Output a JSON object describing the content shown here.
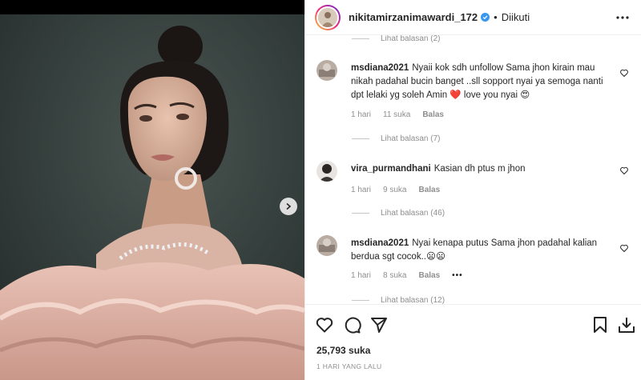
{
  "header": {
    "username": "nikitamirzanimawardi_172",
    "separator": "•",
    "follow_state": "Diikuti"
  },
  "comments": {
    "top_replies": "Lihat balasan (2)",
    "items": [
      {
        "username": "msdiana2021",
        "text": "Nyaii kok sdh unfollow Sama jhon kirain mau nikah padahal bucin banget ..sll sopport nyai ya semoga nanti dpt lelaki yg soleh Amin ❤️ love you nyai 😍",
        "time": "1 hari",
        "likes": "11 suka",
        "reply": "Balas",
        "replies": "Lihat balasan (7)"
      },
      {
        "username": "vira_purmandhani",
        "text": "Kasian dh ptus m jhon",
        "time": "1 hari",
        "likes": "9 suka",
        "reply": "Balas",
        "replies": "Lihat balasan (46)"
      },
      {
        "username": "msdiana2021",
        "text": "Nyai kenapa putus Sama jhon padahal kalian berdua sgt cocok..😦😦",
        "time": "1 hari",
        "likes": "8 suka",
        "reply": "Balas",
        "more": "•••",
        "replies": "Lihat balasan (12)"
      }
    ]
  },
  "actions": {
    "likes": "25,793 suka",
    "posted": "1 HARI YANG LALU"
  },
  "icons": {
    "like": "heart-icon",
    "comment": "comment-icon",
    "share": "send-icon",
    "save": "bookmark-icon",
    "download": "download-icon",
    "next": "chevron-right-icon",
    "more": "more-horizontal-icon",
    "verified": "verified-badge-icon"
  },
  "colors": {
    "verified": "#3897f0",
    "text": "#262626",
    "muted": "#8e8e8e",
    "heart_emoji": "#d7263d"
  }
}
